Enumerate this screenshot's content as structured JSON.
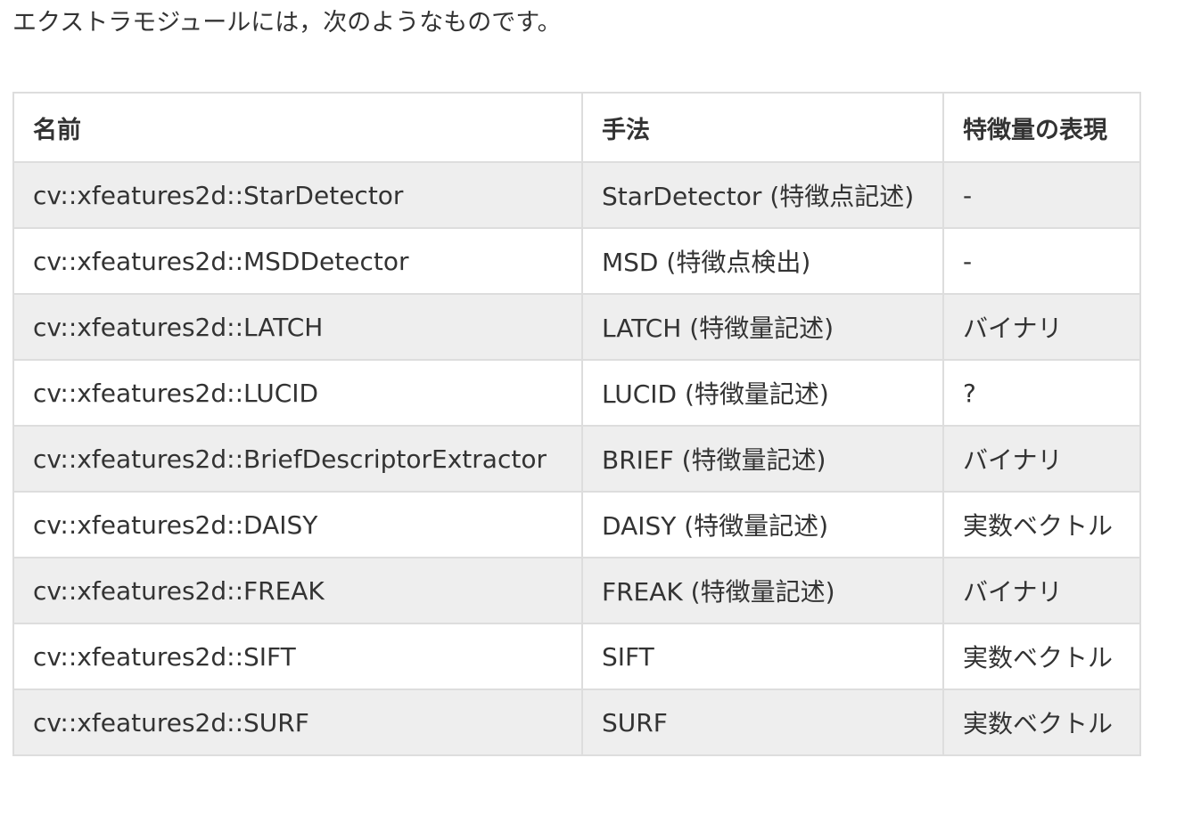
{
  "intro_text": "エクストラモジュールには，次のようなものです。",
  "table": {
    "headers": [
      "名前",
      "手法",
      "特徴量の表現"
    ],
    "rows": [
      [
        "cv::xfeatures2d::StarDetector",
        "StarDetector (特徴点記述)",
        "-"
      ],
      [
        "cv::xfeatures2d::MSDDetector",
        "MSD (特徴点検出)",
        "-"
      ],
      [
        "cv::xfeatures2d::LATCH",
        "LATCH (特徴量記述)",
        "バイナリ"
      ],
      [
        "cv::xfeatures2d::LUCID",
        "LUCID (特徴量記述)",
        "?"
      ],
      [
        "cv::xfeatures2d::BriefDescriptorExtractor",
        "BRIEF (特徴量記述)",
        "バイナリ"
      ],
      [
        "cv::xfeatures2d::DAISY",
        "DAISY (特徴量記述)",
        "実数ベクトル"
      ],
      [
        "cv::xfeatures2d::FREAK",
        "FREAK (特徴量記述)",
        "バイナリ"
      ],
      [
        "cv::xfeatures2d::SIFT",
        "SIFT",
        "実数ベクトル"
      ],
      [
        "cv::xfeatures2d::SURF",
        "SURF",
        "実数ベクトル"
      ]
    ]
  }
}
